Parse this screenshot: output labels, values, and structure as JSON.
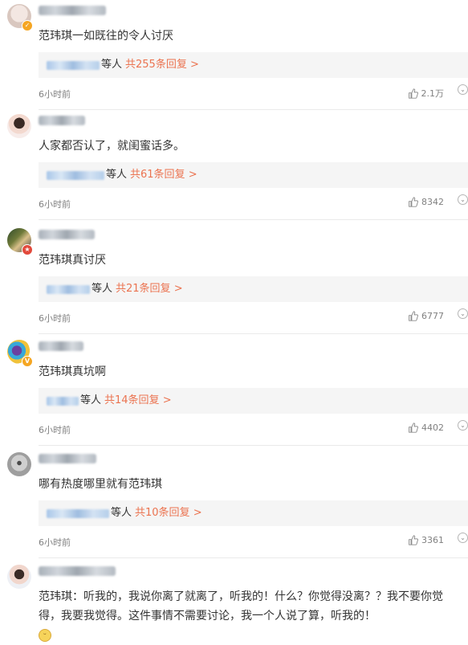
{
  "comments": [
    {
      "content": "范玮琪一如既往的令人讨厌",
      "reply_suffix": "等人",
      "reply_link": "共255条回复 >",
      "time": "6小时前",
      "likes": "2.1万"
    },
    {
      "content": "人家都否认了，就闺蜜话多。",
      "reply_suffix": "等人",
      "reply_link": "共61条回复 >",
      "time": "6小时前",
      "likes": "8342"
    },
    {
      "content": "范玮琪真讨厌",
      "reply_suffix": "等人",
      "reply_link": "共21条回复 >",
      "time": "6小时前",
      "likes": "6777"
    },
    {
      "content": "范玮琪真坑啊",
      "reply_suffix": "等人",
      "reply_link": "共14条回复 >",
      "time": "6小时前",
      "likes": "4402"
    },
    {
      "content": "哪有热度哪里就有范玮琪",
      "reply_suffix": "等人",
      "reply_link": "共10条回复 >",
      "time": "6小时前",
      "likes": "3361"
    },
    {
      "content": "范玮琪：听我的，我说你离了就离了，听我的！什么？你觉得没离？？我不要你觉得，我要我觉得。这件事情不需要讨论，我一个人说了算，听我的！"
    }
  ],
  "icons": {
    "like": "thumbs-up-icon",
    "more": "more-options-icon",
    "emoji": "smiley-emoji-icon",
    "verified_gold": "verified-badge-icon",
    "verified_red": "vip-badge-icon"
  },
  "colors": {
    "link": "#eb7350",
    "muted": "#808080",
    "reply_bg": "#f5f5f5"
  }
}
